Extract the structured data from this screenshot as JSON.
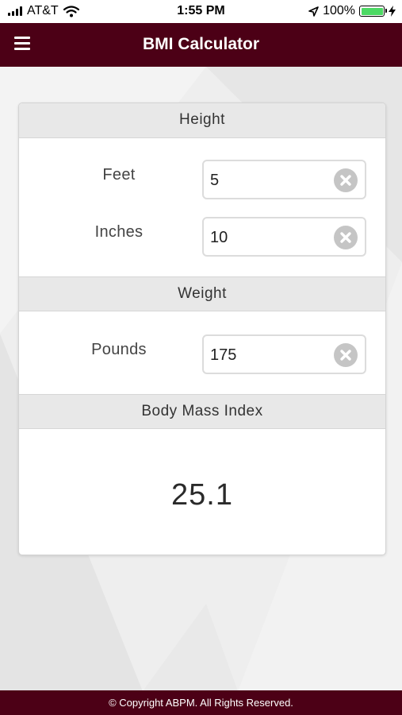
{
  "status_bar": {
    "carrier": "AT&T",
    "time": "1:55 PM",
    "battery_percent": "100%",
    "battery_level": 1.0,
    "icons": [
      "signal-icon",
      "wifi-icon",
      "location-icon",
      "battery-icon",
      "charging-icon"
    ]
  },
  "header": {
    "title": "BMI Calculator",
    "menu_icon": "hamburger-menu-icon",
    "background_color": "#4c0016"
  },
  "height_section": {
    "title": "Height",
    "feet": {
      "label": "Feet",
      "value": "5"
    },
    "inches": {
      "label": "Inches",
      "value": "10"
    }
  },
  "weight_section": {
    "title": "Weight",
    "pounds": {
      "label": "Pounds",
      "value": "175"
    }
  },
  "bmi_section": {
    "title": "Body Mass Index",
    "value": "25.1"
  },
  "footer": {
    "text": "© Copyright ABPM. All Rights Reserved."
  },
  "colors": {
    "brand": "#4c0016",
    "section_header_bg": "#e8e8e8",
    "clear_icon": "#c5c5c5",
    "battery_fill": "#4cd964"
  }
}
